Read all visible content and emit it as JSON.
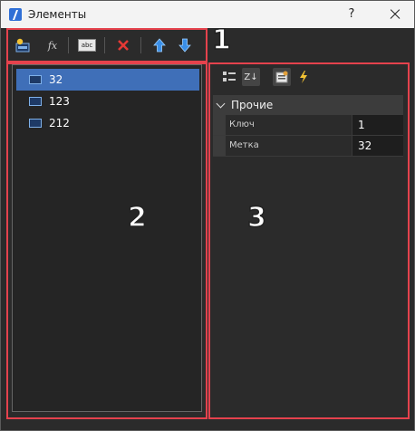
{
  "window": {
    "title": "Элементы",
    "help_label": "?"
  },
  "toolbar": {
    "buttons": [
      {
        "name": "add-item-icon"
      },
      {
        "name": "function-icon",
        "label": "fx"
      },
      {
        "name": "rename-icon",
        "label": "abc"
      },
      {
        "name": "delete-icon"
      },
      {
        "name": "move-up-icon"
      },
      {
        "name": "move-down-icon"
      }
    ]
  },
  "list": {
    "items": [
      {
        "label": "32",
        "selected": true
      },
      {
        "label": "123",
        "selected": false
      },
      {
        "label": "212",
        "selected": false
      }
    ]
  },
  "property_grid": {
    "toolbar": [
      "categorized-icon",
      "alphabetical-sort-icon",
      "properties-page-icon",
      "events-icon"
    ],
    "sort_label": "Z↓",
    "category": "Прочие",
    "properties": [
      {
        "name": "Ключ",
        "value": "1"
      },
      {
        "name": "Метка",
        "value": "32"
      }
    ]
  },
  "annotations": {
    "labels": [
      "1",
      "2",
      "3"
    ],
    "color": "#e5424d"
  },
  "colors": {
    "selection": "#3f6fb8",
    "panel_bg": "#2b2b2b",
    "delete_red": "#e53935",
    "arrow_blue": "#3a8fe8"
  }
}
